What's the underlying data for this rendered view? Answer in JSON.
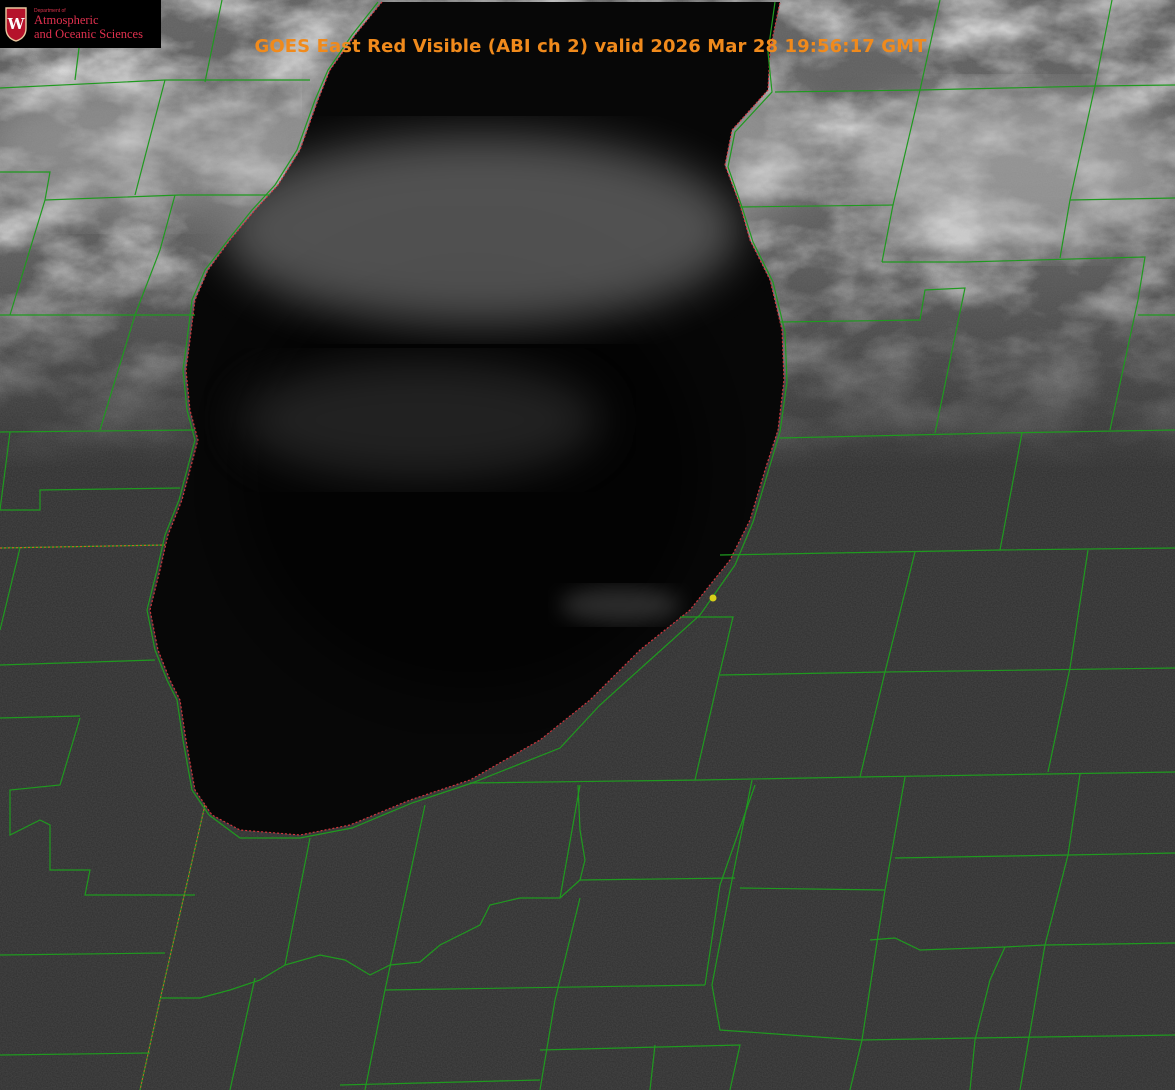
{
  "header": {
    "title": "GOES East Red Visible (ABI ch 2) valid 2026 Mar 28 19:56:17 GMT"
  },
  "logo": {
    "department": "Department of",
    "line1": "Atmospheric",
    "line2": "and Oceanic Sciences",
    "crest_letter": "W"
  },
  "colors": {
    "title": "#f08a1c",
    "boundary": "#1f9a1f",
    "shoreline": "#d2343c",
    "marker": "#d8cf1a",
    "lake": "#060606",
    "land": "#303030",
    "cloud": "#c8c8c8"
  }
}
